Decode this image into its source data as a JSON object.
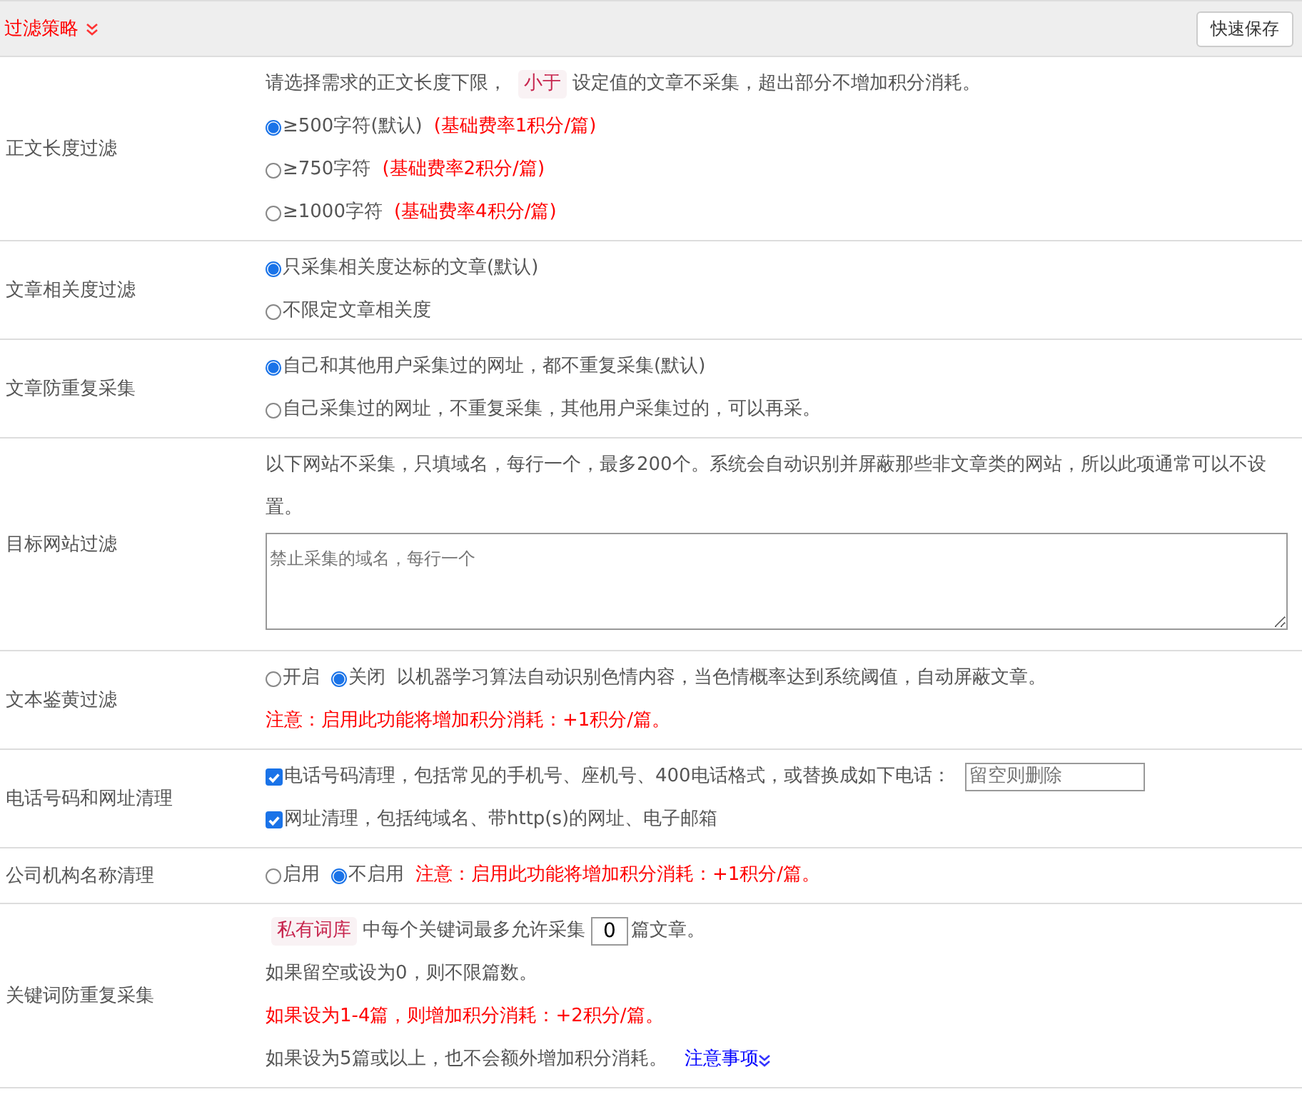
{
  "header": {
    "title": "过滤策略",
    "button": "快速保存"
  },
  "rows": [
    {
      "label": "正文长度过滤",
      "lines": [
        [
          {
            "kind": "text",
            "text": "请选择需求的正文长度下限，"
          },
          {
            "kind": "tag",
            "text": "小于"
          },
          {
            "kind": "text",
            "text": "设定值的文章不采集，超出部分不增加积分消耗。"
          }
        ],
        [
          {
            "kind": "radio",
            "text": "≥500字符(默认)",
            "selected": true
          },
          {
            "kind": "warn",
            "text": "(基础费率1积分/篇)"
          }
        ],
        [
          {
            "kind": "radio",
            "text": "≥750字符",
            "selected": false
          },
          {
            "kind": "warn",
            "text": "(基础费率2积分/篇)"
          }
        ],
        [
          {
            "kind": "radio",
            "text": "≥1000字符",
            "selected": false
          },
          {
            "kind": "warn",
            "text": "(基础费率4积分/篇)"
          }
        ]
      ]
    },
    {
      "label": "文章相关度过滤",
      "lines": [
        [
          {
            "kind": "radio",
            "text": "只采集相关度达标的文章(默认)",
            "selected": true
          }
        ],
        [
          {
            "kind": "radio",
            "text": "不限定文章相关度",
            "selected": false
          }
        ]
      ]
    },
    {
      "label": "文章防重复采集",
      "lines": [
        [
          {
            "kind": "radio",
            "text": "自己和其他用户采集过的网址，都不重复采集(默认)",
            "selected": true
          }
        ],
        [
          {
            "kind": "radio",
            "text": "自己采集过的网址，不重复采集，其他用户采集过的，可以再采。",
            "selected": false
          }
        ]
      ]
    },
    {
      "label": "目标网站过滤",
      "lines": [
        [
          {
            "kind": "text",
            "text": "以下网站不采集，只填域名，每行一个，最多200个。系统会自动识别并屏蔽那些非文章类的网站，所以此项通常可以不设置。"
          }
        ],
        [
          {
            "kind": "textarea",
            "placeholder": "禁止采集的域名，每行一个"
          }
        ]
      ]
    },
    {
      "label": "文本鉴黄过滤",
      "lines": [
        [
          {
            "kind": "radio",
            "text": "开启",
            "selected": false
          },
          {
            "kind": "radio",
            "text": "关闭",
            "selected": true
          },
          {
            "kind": "text",
            "text": "以机器学习算法自动识别色情内容，当色情概率达到系统阈值，自动屏蔽文章。"
          }
        ],
        [
          {
            "kind": "warn",
            "text": "注意：启用此功能将增加积分消耗：+1积分/篇。"
          }
        ]
      ]
    },
    {
      "label": "电话号码和网址清理",
      "lines": [
        [
          {
            "kind": "checkbox",
            "text": "电话号码清理，包括常见的手机号、座机号、400电话格式，或替换成如下电话：",
            "checked": true
          },
          {
            "kind": "input",
            "placeholder": "留空则删除"
          }
        ],
        [
          {
            "kind": "checkbox",
            "text": "网址清理，包括纯域名、带http(s)的网址、电子邮箱",
            "checked": true
          }
        ]
      ]
    },
    {
      "label": "公司机构名称清理",
      "lines": [
        [
          {
            "kind": "radio",
            "text": "启用",
            "selected": false
          },
          {
            "kind": "radio",
            "text": "不启用",
            "selected": true
          },
          {
            "kind": "warn",
            "text": "注意：启用此功能将增加积分消耗：+1积分/篇。"
          }
        ]
      ]
    },
    {
      "label": "关键词防重复采集",
      "lines": [
        [
          {
            "kind": "tag",
            "text": "私有词库"
          },
          {
            "kind": "text",
            "text": "中每个关键词最多允许采集"
          },
          {
            "kind": "number",
            "value": "0"
          },
          {
            "kind": "text",
            "text": "篇文章。"
          }
        ],
        [
          {
            "kind": "text",
            "text": "如果留空或设为0，则不限篇数。"
          }
        ],
        [
          {
            "kind": "warn",
            "text": "如果设为1-4篇，则增加积分消耗：+2积分/篇。"
          }
        ],
        [
          {
            "kind": "text",
            "text": "如果设为5篇或以上，也不会额外增加积分消耗。"
          },
          {
            "kind": "link",
            "text": "注意事项"
          }
        ]
      ]
    }
  ]
}
